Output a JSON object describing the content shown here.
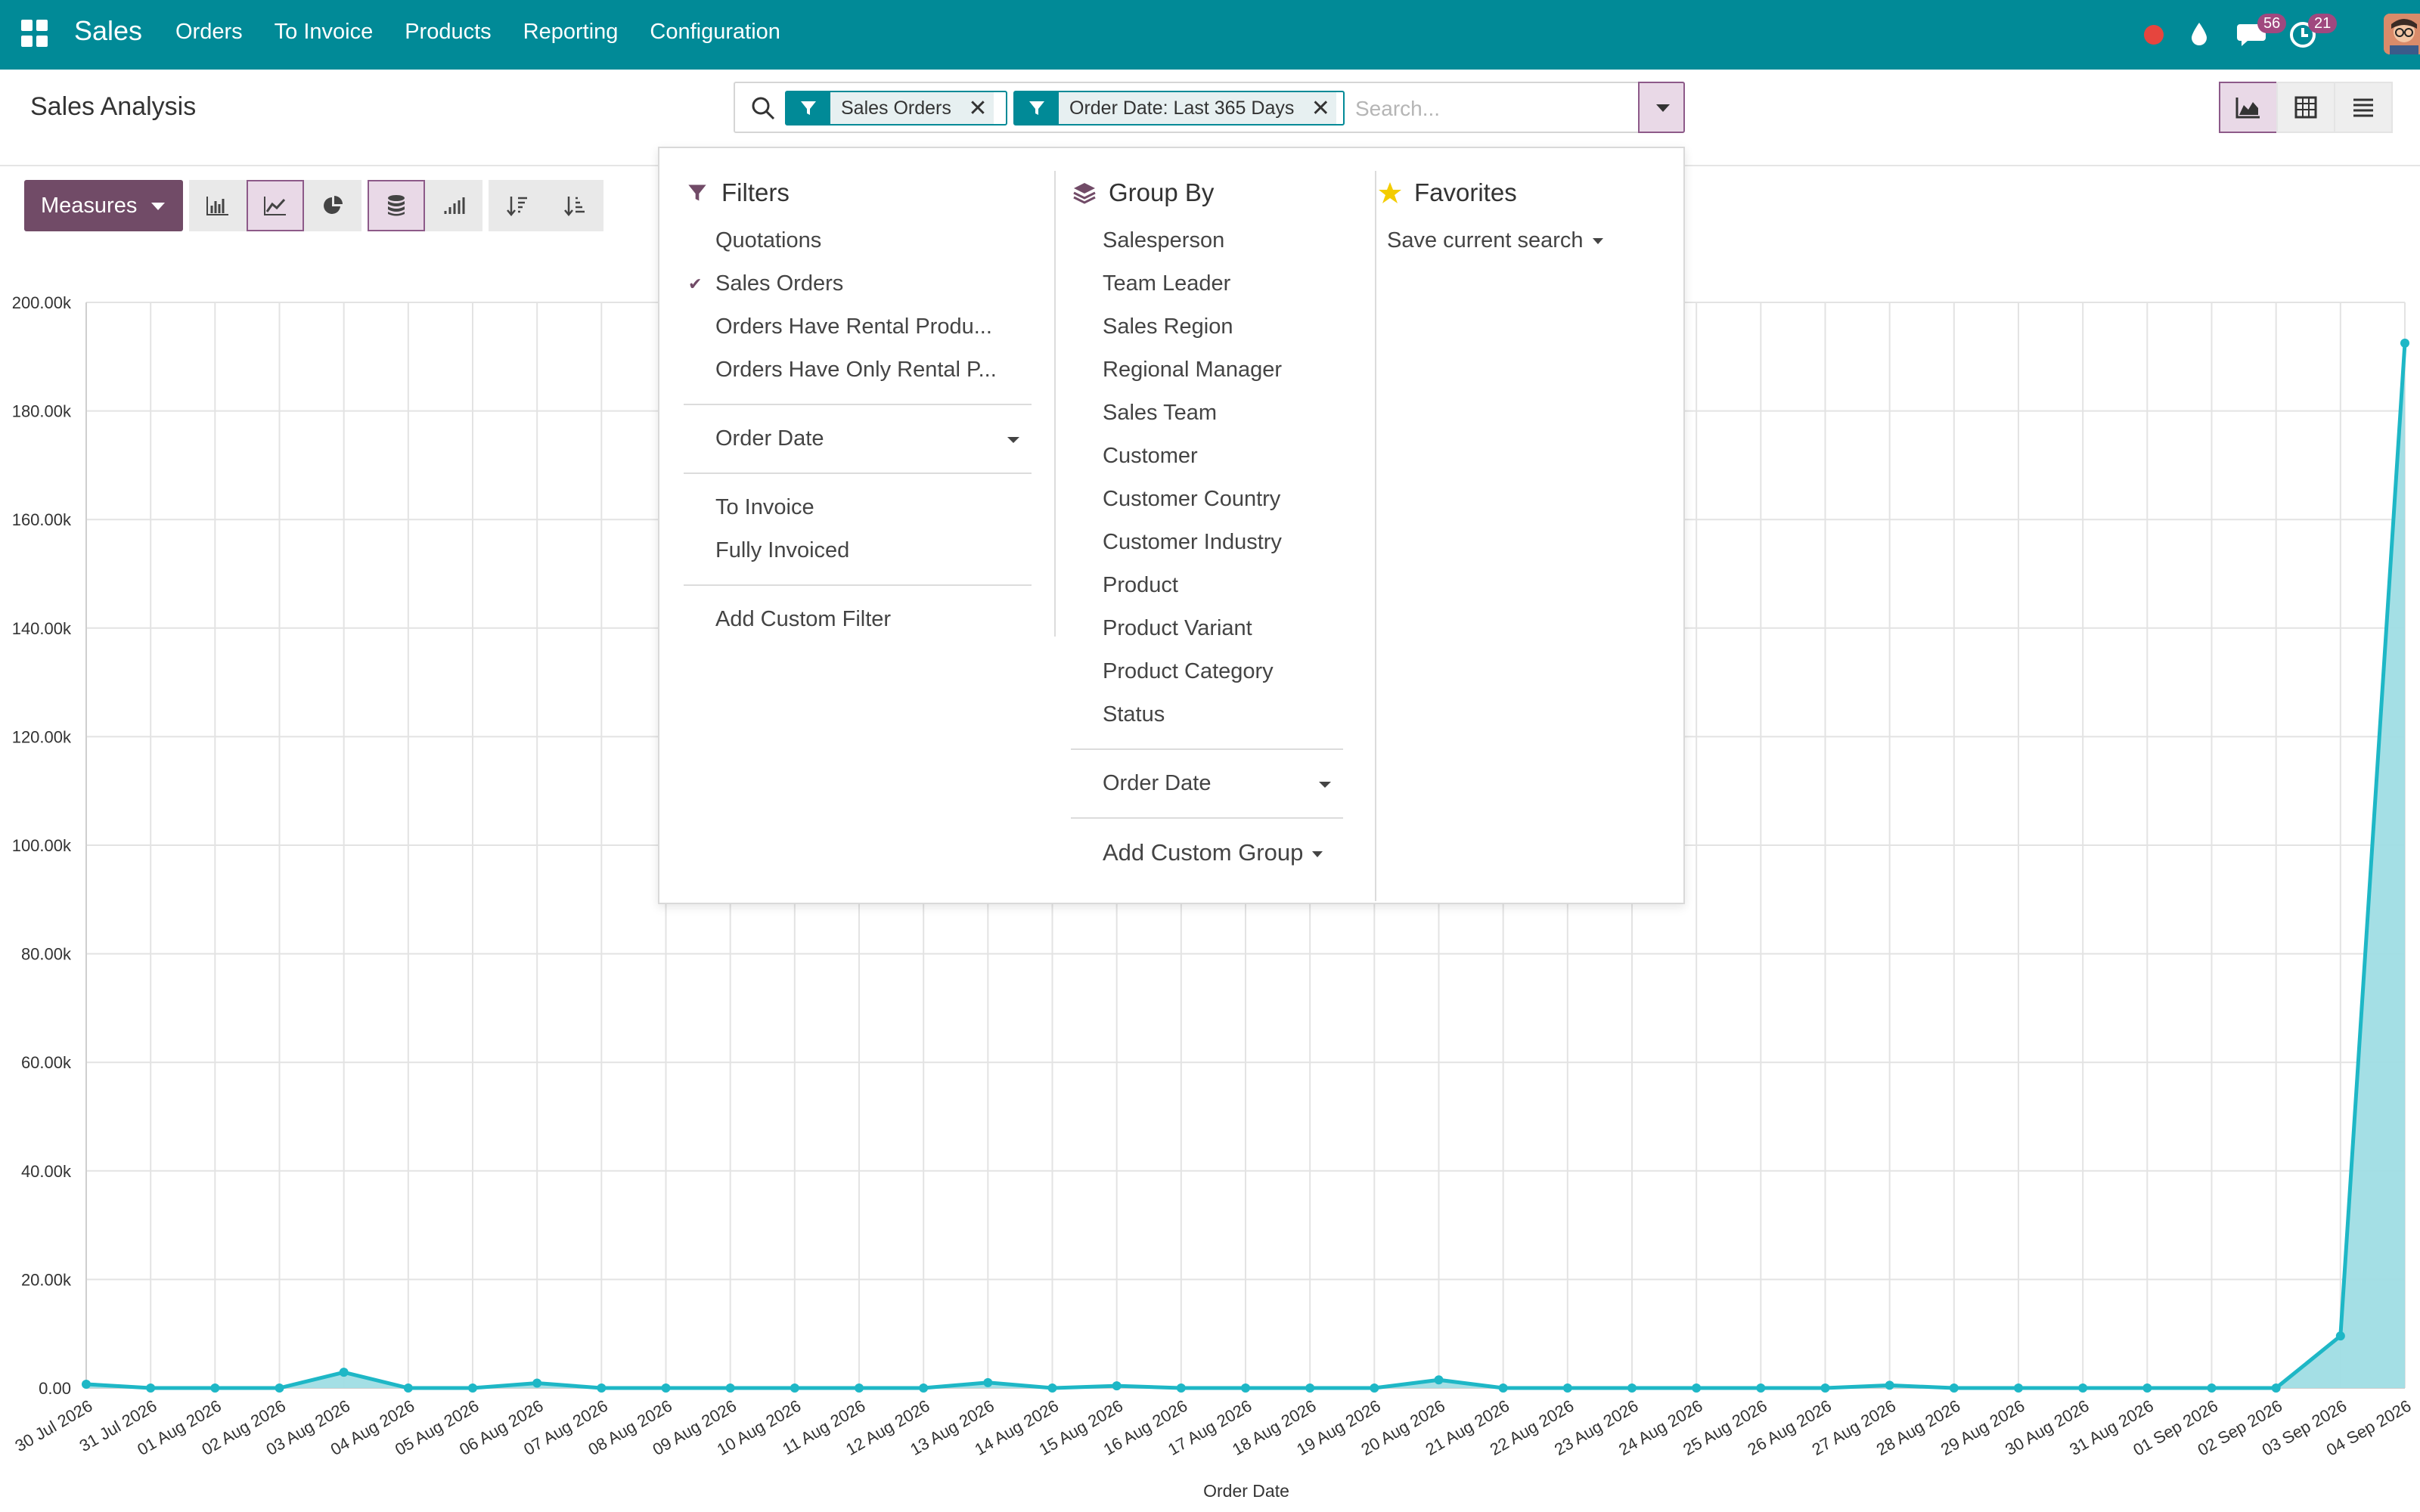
{
  "navbar": {
    "brand": "Sales",
    "menu": [
      "Orders",
      "To Invoice",
      "Products",
      "Reporting",
      "Configuration"
    ],
    "messages_count": "56",
    "activities_count": "21"
  },
  "control_panel": {
    "title": "Sales Analysis",
    "facets": [
      {
        "label": "Sales Orders"
      },
      {
        "label": "Order Date: Last 365 Days"
      }
    ],
    "search_placeholder": "Search...",
    "views": [
      "graph-icon",
      "pivot-icon",
      "list-icon"
    ]
  },
  "toolbar": {
    "measures_label": "Measures"
  },
  "dropdown": {
    "filters": {
      "title": "Filters",
      "items": [
        {
          "label": "Quotations",
          "checked": false
        },
        {
          "label": "Sales Orders",
          "checked": true
        },
        {
          "label": "Orders Have Rental Produ...",
          "checked": false
        },
        {
          "label": "Orders Have Only Rental P...",
          "checked": false
        }
      ],
      "order_date": "Order Date",
      "invoice_items": [
        "To Invoice",
        "Fully Invoiced"
      ],
      "add_custom": "Add Custom Filter"
    },
    "groupby": {
      "title": "Group By",
      "items": [
        "Salesperson",
        "Team Leader",
        "Sales Region",
        "Regional Manager",
        "Sales Team",
        "Customer",
        "Customer Country",
        "Customer Industry",
        "Product",
        "Product Variant",
        "Product Category",
        "Status"
      ],
      "order_date": "Order Date",
      "add_custom": "Add Custom Group"
    },
    "favorites": {
      "title": "Favorites",
      "save": "Save current search"
    }
  },
  "chart_data": {
    "type": "area",
    "xlabel": "Order Date",
    "ylabel": "",
    "ylim": [
      0,
      200000
    ],
    "yticks": [
      "0.00",
      "20.00k",
      "40.00k",
      "60.00k",
      "80.00k",
      "100.00k",
      "120.00k",
      "140.00k",
      "160.00k",
      "180.00k",
      "200.00k"
    ],
    "categories": [
      "30 Jul 2026",
      "31 Jul 2026",
      "01 Aug 2026",
      "02 Aug 2026",
      "03 Aug 2026",
      "04 Aug 2026",
      "05 Aug 2026",
      "06 Aug 2026",
      "07 Aug 2026",
      "08 Aug 2026",
      "09 Aug 2026",
      "10 Aug 2026",
      "11 Aug 2026",
      "12 Aug 2026",
      "13 Aug 2026",
      "14 Aug 2026",
      "15 Aug 2026",
      "16 Aug 2026",
      "17 Aug 2026",
      "18 Aug 2026",
      "19 Aug 2026",
      "20 Aug 2026",
      "21 Aug 2026",
      "22 Aug 2026",
      "23 Aug 2026",
      "24 Aug 2026",
      "25 Aug 2026",
      "26 Aug 2026",
      "27 Aug 2026",
      "28 Aug 2026",
      "29 Aug 2026",
      "30 Aug 2026",
      "31 Aug 2026",
      "01 Sep 2026",
      "02 Sep 2026",
      "03 Sep 2026",
      "04 Sep 2026"
    ],
    "values": [
      700,
      0,
      0,
      0,
      2900,
      0,
      0,
      900,
      0,
      0,
      0,
      0,
      0,
      0,
      1000,
      0,
      400,
      0,
      0,
      0,
      0,
      1500,
      0,
      0,
      0,
      0,
      0,
      0,
      500,
      0,
      0,
      0,
      0,
      0,
      0,
      9600,
      192500
    ],
    "grid": true,
    "colors": {
      "line": "#1eb7c6",
      "fill": "#9fdde4"
    }
  },
  "colors": {
    "navbar": "#018a97",
    "primary": "#714b67"
  }
}
